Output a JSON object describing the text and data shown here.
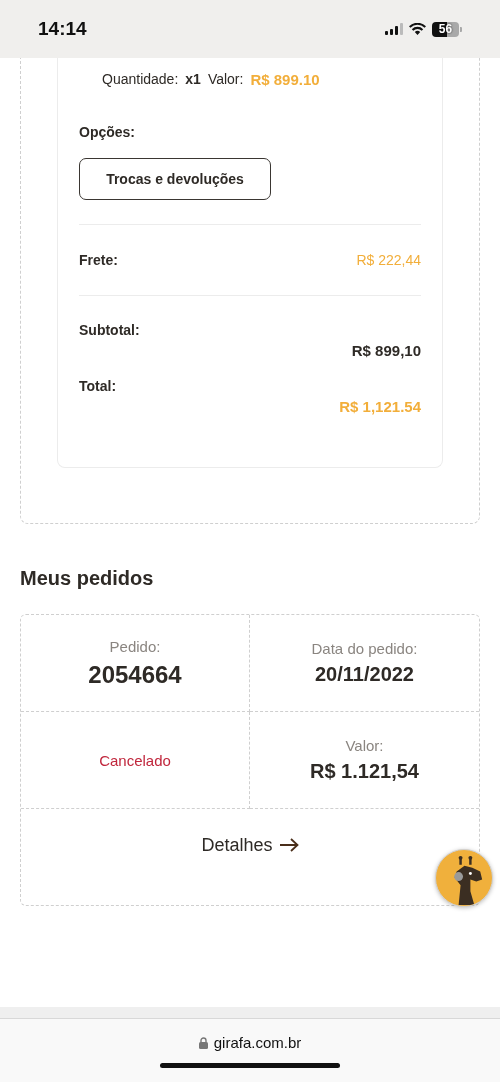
{
  "status_bar": {
    "time": "14:14",
    "battery": "56"
  },
  "order_item": {
    "quantity_label": "Quantidade:",
    "quantity": "x1",
    "value_label": "Valor:",
    "value": "R$ 899.10"
  },
  "options": {
    "label": "Opções:",
    "buttons": [
      "Trocas e devoluções"
    ]
  },
  "summary": [
    {
      "kind": "shipping",
      "label": "Frete:",
      "value": "R$ 222,44"
    },
    {
      "kind": "subtotal",
      "label": "Subtotal:",
      "value": "R$ 899,10"
    },
    {
      "kind": "total",
      "label": "Total:",
      "value": "R$ 1,121.54"
    }
  ],
  "my_orders": {
    "title": "Meus pedidos",
    "rows": [
      {
        "cells": [
          {
            "kind": "field",
            "label": "Pedido:",
            "value": "2054664"
          },
          {
            "kind": "field",
            "label": "Data do pedido:",
            "value": "20/11/2022"
          }
        ]
      },
      {
        "cells": [
          {
            "kind": "status",
            "value": "Cancelado"
          },
          {
            "kind": "field",
            "label": "Valor:",
            "value": "R$ 1.121,54"
          }
        ]
      }
    ],
    "details_link": "Detalhes"
  },
  "browser": {
    "url": "girafa.com.br"
  }
}
